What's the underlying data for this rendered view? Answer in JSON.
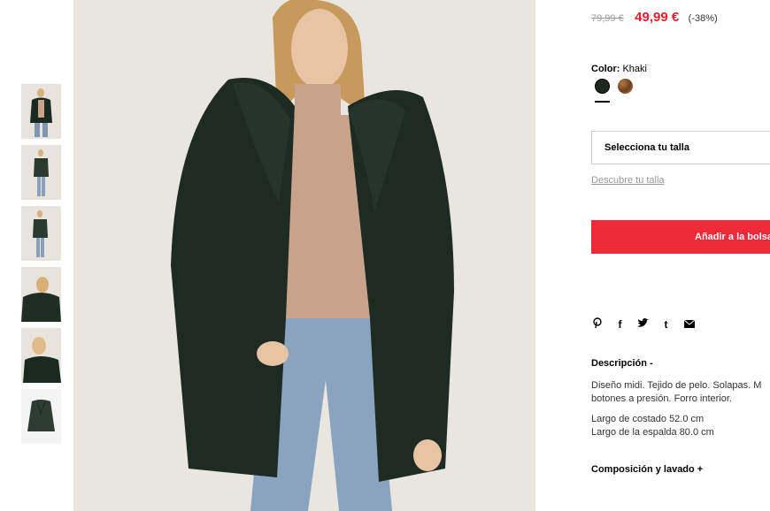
{
  "price": {
    "old": "79,99 €",
    "new": "49,99 €",
    "discount": "(-38%)"
  },
  "color": {
    "label": "Color:",
    "value": "Khaki",
    "swatches": [
      "#1c2a20",
      "#8a5a30"
    ]
  },
  "size": {
    "select_label": "Selecciona tu talla",
    "link": "Descubre tu talla"
  },
  "cart": {
    "add_label": "Añadir a la bolsa"
  },
  "share": {
    "icons": [
      "pinterest-icon",
      "facebook-icon",
      "twitter-icon",
      "tumblr-icon",
      "email-icon"
    ],
    "glyphs": [
      "℗",
      "f",
      "🐦",
      "t",
      "✉"
    ]
  },
  "description": {
    "title": "Descripción -",
    "line1": "Diseño midi. Tejido de pelo. Solapas. M",
    "line2": "botones a presión. Forro interior.",
    "meas1": "Largo de costado 52.0 cm",
    "meas2": "Largo de la espalda 80.0 cm"
  },
  "composition": {
    "title": "Composición y lavado +"
  }
}
